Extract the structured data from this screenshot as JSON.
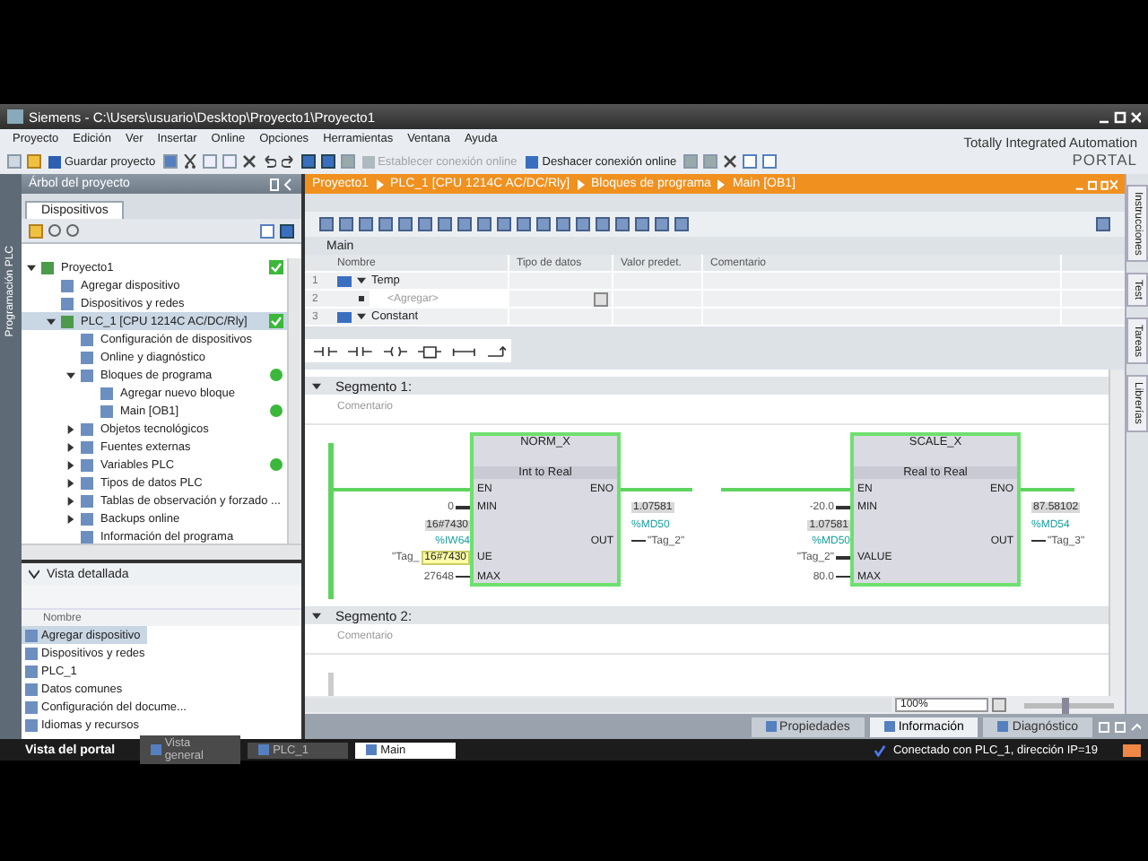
{
  "window": {
    "title": "Siemens - C:\\Users\\usuario\\Desktop\\Proyecto1\\Proyecto1"
  },
  "menu": [
    "Proyecto",
    "Edición",
    "Ver",
    "Insertar",
    "Online",
    "Opciones",
    "Herramientas",
    "Ventana",
    "Ayuda"
  ],
  "toolbar": {
    "save": "Guardar proyecto",
    "connect": {
      "label": "Establecer conexión online",
      "disabled": true
    },
    "disconnect": {
      "label": "Deshacer conexión online",
      "disabled": false
    }
  },
  "brand": {
    "line_1": "Totally Integrated Automation",
    "line_2": "PORTAL"
  },
  "side_tab": "Programación PLC",
  "project_tree": {
    "title": "Árbol del proyecto",
    "tabs": [
      {
        "label": "Dispositivos",
        "selected": true
      }
    ],
    "items": [
      {
        "label": "Proyecto1",
        "kind": "device",
        "expanded": true,
        "online_ok": true,
        "selected": false,
        "children": [
          {
            "label": "Agregar dispositivo",
            "selected": false
          },
          {
            "label": "Dispositivos y redes",
            "selected": false
          },
          {
            "label": "PLC_1 [CPU 1214C AC/DC/Rly]",
            "kind": "device",
            "expanded": true,
            "online_ok": true,
            "selected": true,
            "children": [
              {
                "label": "Configuración de dispositivos",
                "selected": false
              },
              {
                "label": "Online y diagnóstico",
                "selected": false
              },
              {
                "label": "Bloques de programa",
                "expanded": true,
                "online_ok": true,
                "selected": false,
                "children": [
                  {
                    "label": "Agregar nuevo bloque",
                    "selected": false
                  },
                  {
                    "label": "Main [OB1]",
                    "online_ok": true,
                    "selected": false
                  }
                ]
              },
              {
                "label": "Objetos tecnológicos",
                "expanded": false,
                "selected": false
              },
              {
                "label": "Fuentes externas",
                "expanded": false,
                "selected": false
              },
              {
                "label": "Variables PLC",
                "expanded": false,
                "online_ok": true,
                "selected": false
              },
              {
                "label": "Tipos de datos PLC",
                "expanded": false,
                "selected": false
              },
              {
                "label": "Tablas de observación y forzado ...",
                "expanded": false,
                "selected": false
              },
              {
                "label": "Backups online",
                "expanded": false,
                "selected": false
              },
              {
                "label": "Información del programa",
                "selected": false
              }
            ]
          }
        ]
      }
    ]
  },
  "detail_view": {
    "title": "Vista detallada",
    "column": "Nombre",
    "items": [
      {
        "label": "Agregar dispositivo",
        "selected": true
      },
      {
        "label": "Dispositivos y redes",
        "selected": false
      },
      {
        "label": "PLC_1",
        "selected": false
      },
      {
        "label": "Datos comunes",
        "selected": false
      },
      {
        "label": "Configuración del docume...",
        "selected": false
      },
      {
        "label": "Idiomas y recursos",
        "selected": false
      }
    ]
  },
  "editor": {
    "breadcrumb": [
      "Proyecto1",
      "PLC_1 [CPU 1214C AC/DC/Rly]",
      "Bloques de programa",
      "Main [OB1]"
    ],
    "block": "Main",
    "columns": [
      "Nombre",
      "Tipo de datos",
      "Valor predet.",
      "Comentario"
    ],
    "rows": [
      {
        "number": "1",
        "name": "Temp",
        "kind": "section"
      },
      {
        "number": "2",
        "name": "<Agregar>",
        "kind": "add"
      },
      {
        "number": "3",
        "name": "Constant",
        "kind": "section"
      }
    ],
    "segments": [
      {
        "title": "Segmento 1:",
        "comment": "Comentario",
        "boxes": [
          {
            "name": "NORM_X",
            "subtitle": "Int to Real",
            "en": "EN",
            "eno": "ENO",
            "min": {
              "pin": "MIN",
              "value": "0"
            },
            "input": {
              "pin": "UE",
              "value": "16#7430",
              "address": "%IW64",
              "tag": "\"Tag_",
              "tooltip": "16#7430"
            },
            "max": {
              "pin": "MAX",
              "value": "27648"
            },
            "out": {
              "pin": "OUT",
              "value": "1.07581",
              "address": "%MD50",
              "tag": "\"Tag_2\""
            }
          },
          {
            "name": "SCALE_X",
            "subtitle": "Real to Real",
            "en": "EN",
            "eno": "ENO",
            "min": {
              "pin": "MIN",
              "value": "-20.0"
            },
            "input": {
              "pin": "VALUE",
              "value": "1.07581",
              "address": "%MD50",
              "tag": "\"Tag_2\""
            },
            "max": {
              "pin": "MAX",
              "value": "80.0"
            },
            "out": {
              "pin": "OUT",
              "value": "87.58102",
              "address": "%MD54",
              "tag": "\"Tag_3\""
            }
          }
        ]
      },
      {
        "title": "Segmento 2:",
        "comment": "Comentario"
      }
    ],
    "zoom": "100%",
    "zoom_slider": {
      "level": 0.45
    }
  },
  "task_cards": [
    "Instrucciones",
    "Test",
    "Tareas",
    "Librerías"
  ],
  "inspector_tabs": [
    {
      "label": "Propiedades",
      "selected": false
    },
    {
      "label": "Información",
      "selected": true
    },
    {
      "label": "Diagnóstico",
      "selected": false
    }
  ],
  "taskbar": {
    "portal": "Vista del portal",
    "tabs": [
      {
        "label": "Vista general",
        "selected": false
      },
      {
        "label": "PLC_1",
        "selected": false
      },
      {
        "label": "Main",
        "selected": true
      }
    ],
    "status": "Conectado con PLC_1, dirección IP=19"
  }
}
